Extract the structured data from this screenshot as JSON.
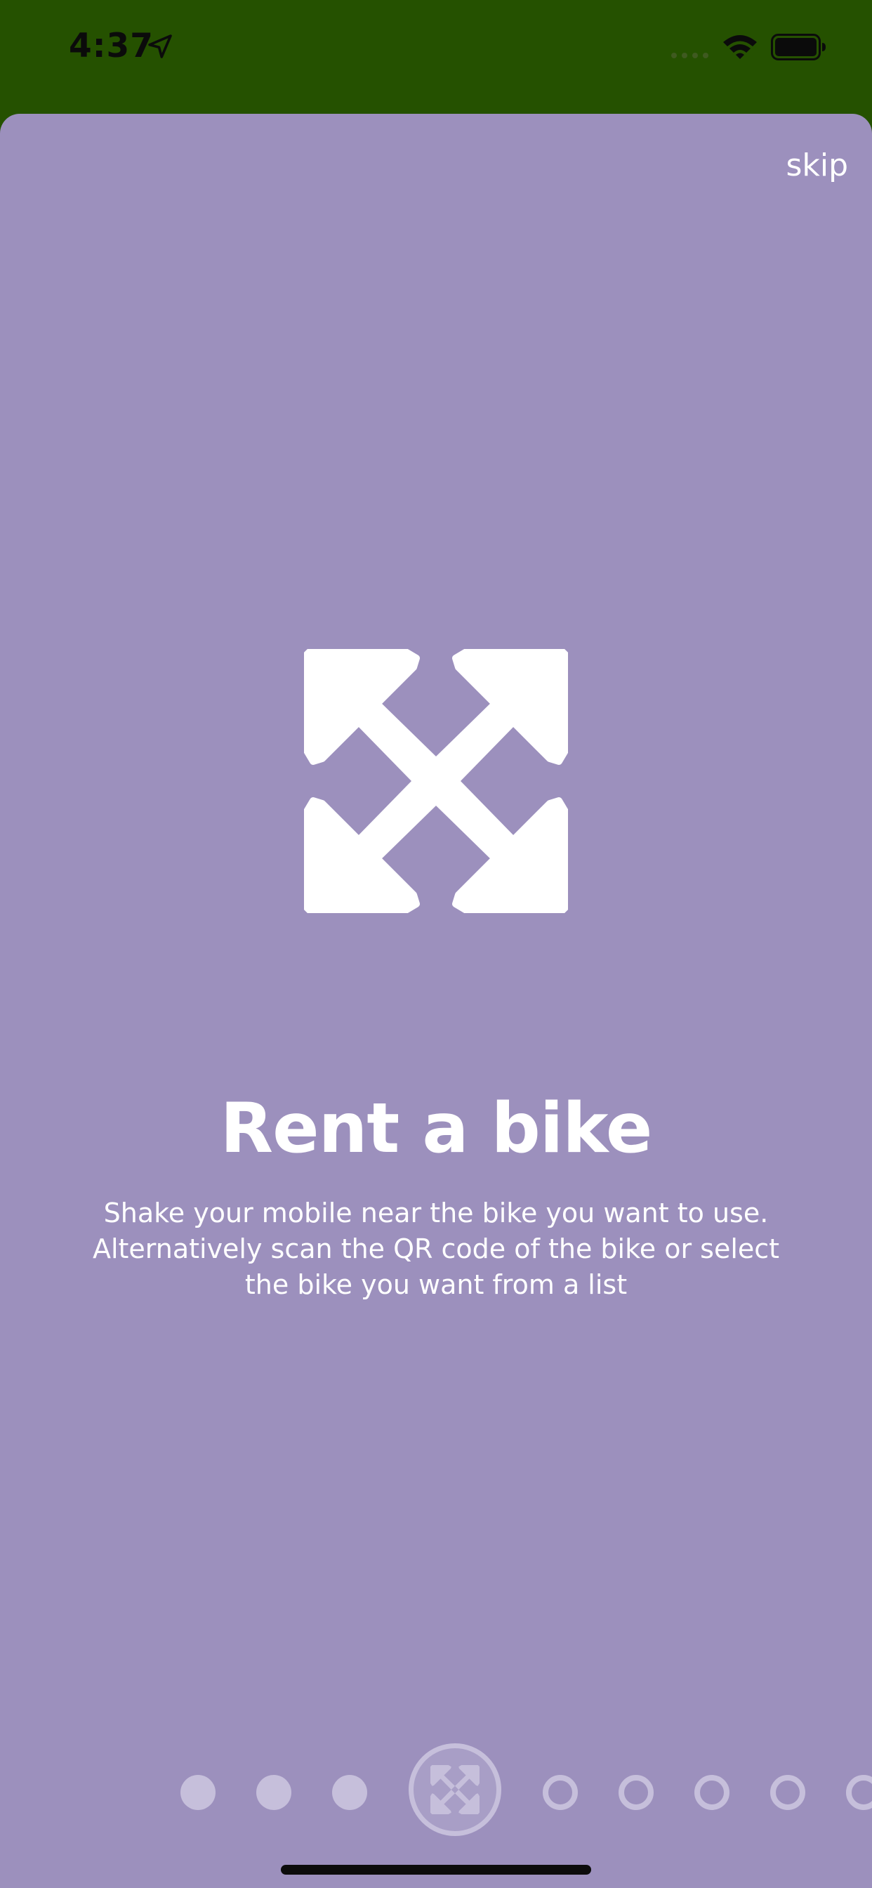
{
  "status_bar": {
    "time": "4:37",
    "icons": [
      "location-arrow-icon",
      "cellular-signal-icon",
      "wifi-icon",
      "battery-icon"
    ]
  },
  "onboarding": {
    "skip_label": "skip",
    "illustration_icon": "expand-arrows-icon",
    "title": "Rent a bike",
    "description": "Shake your mobile near the bike you want to use. Alternatively scan the QR code of the bike or select the bike you want from a list",
    "pager": {
      "total_visible": 9,
      "current_index": 3,
      "current_icon": "expand-arrows-icon"
    }
  },
  "colors": {
    "status_bar_bg": "#255100",
    "sheet_bg": "#9c90bd",
    "text": "#ffffff",
    "pager_dot": "#c6bfdb"
  }
}
